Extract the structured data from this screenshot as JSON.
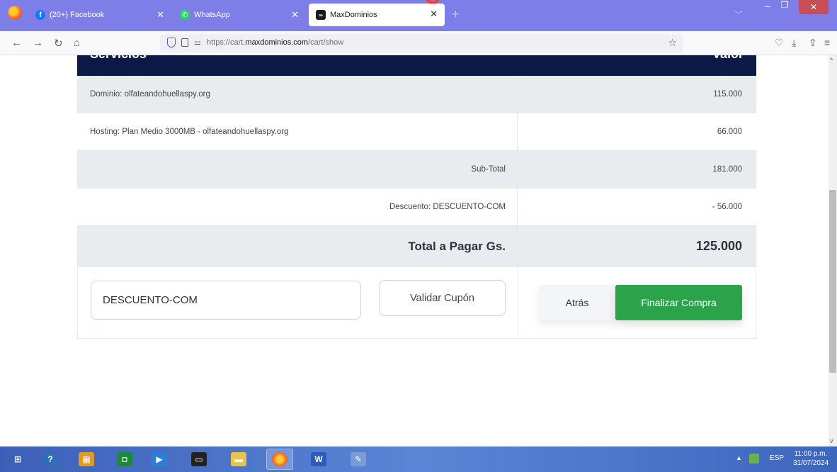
{
  "browser": {
    "tabs": [
      {
        "label": "(20+) Facebook",
        "icon": "facebook-icon"
      },
      {
        "label": "WhatsApp",
        "icon": "whatsapp-icon"
      },
      {
        "label": "MaxDominios",
        "icon": "maxdominios-icon",
        "active": true
      }
    ],
    "url_prefix": "https://cart.",
    "url_host": "maxdominios.com",
    "url_path": "/cart/show"
  },
  "cart": {
    "header_services": "Servicios",
    "header_value": "Valor",
    "items": [
      {
        "description": "Dominio: olfateandohuellaspy.org",
        "value": "115.000"
      },
      {
        "description": "Hosting: Plan Medio 3000MB - olfateandohuellaspy.org",
        "value": "66.000"
      }
    ],
    "subtotal_label": "Sub-Total",
    "subtotal_value": "181.000",
    "discount_label": "Descuento: DESCUENTO-COM",
    "discount_value": "- 56.000",
    "total_label": "Total a Pagar Gs.",
    "total_value": "125.000",
    "coupon_value": "DESCUENTO-COM",
    "validate_label": "Validar Cupón",
    "back_label": "Atrás",
    "finish_label": "Finalizar Compra"
  },
  "taskbar": {
    "language": "ESP",
    "time": "11:00 p.m.",
    "date": "31/07/2024"
  },
  "colors": {
    "header_bg": "#0a1a45",
    "finish_button": "#2aa34a",
    "tab_bar": "#7d7ee8"
  }
}
